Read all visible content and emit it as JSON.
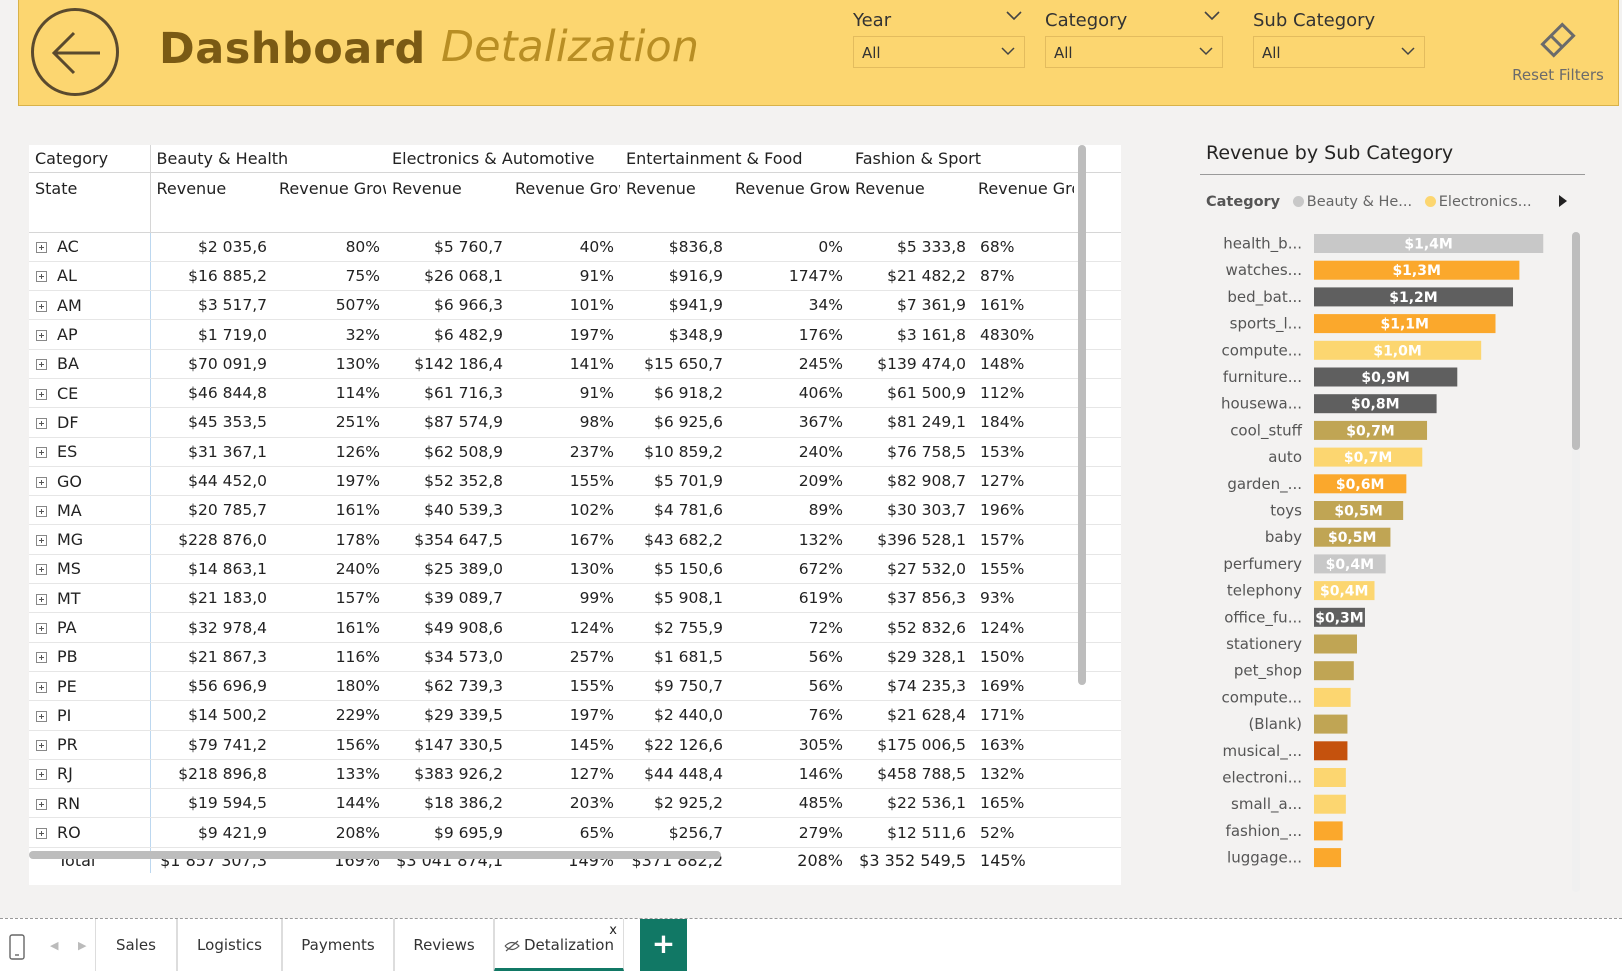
{
  "header": {
    "title": "Dashboard",
    "subtitle": "Detalization",
    "reset_label": "Reset Filters"
  },
  "filters": [
    {
      "label": "Year",
      "value": "All"
    },
    {
      "label": "Category",
      "value": "All"
    },
    {
      "label": "Sub Category",
      "value": "All"
    }
  ],
  "matrix": {
    "corner_col_header": "Category",
    "corner_row_header": "State",
    "categories": [
      "Beauty & Health",
      "Electronics & Automotive",
      "Entertainment & Food",
      "Fashion & Sport"
    ],
    "measure_headers": [
      "Revenue",
      "Revenue Growth %"
    ],
    "rows": [
      {
        "state": "AC",
        "cells": [
          "$2 035,6",
          "80%",
          "$5 760,7",
          "40%",
          "$836,8",
          "0%",
          "$5 333,8",
          "68%"
        ]
      },
      {
        "state": "AL",
        "cells": [
          "$16 885,2",
          "75%",
          "$26 068,1",
          "91%",
          "$916,9",
          "1747%",
          "$21 482,2",
          "87%"
        ]
      },
      {
        "state": "AM",
        "cells": [
          "$3 517,7",
          "507%",
          "$6 966,3",
          "101%",
          "$941,9",
          "34%",
          "$7 361,9",
          "161%"
        ]
      },
      {
        "state": "AP",
        "cells": [
          "$1 719,0",
          "32%",
          "$6 482,9",
          "197%",
          "$348,9",
          "176%",
          "$3 161,8",
          "4830%"
        ]
      },
      {
        "state": "BA",
        "cells": [
          "$70 091,9",
          "130%",
          "$142 186,4",
          "141%",
          "$15 650,7",
          "245%",
          "$139 474,0",
          "148%"
        ]
      },
      {
        "state": "CE",
        "cells": [
          "$46 844,8",
          "114%",
          "$61 716,3",
          "91%",
          "$6 918,2",
          "406%",
          "$61 500,9",
          "112%"
        ]
      },
      {
        "state": "DF",
        "cells": [
          "$45 353,5",
          "251%",
          "$87 574,9",
          "98%",
          "$6 925,6",
          "367%",
          "$81 249,1",
          "184%"
        ]
      },
      {
        "state": "ES",
        "cells": [
          "$31 367,1",
          "126%",
          "$62 508,9",
          "237%",
          "$10 859,2",
          "240%",
          "$76 758,5",
          "153%"
        ]
      },
      {
        "state": "GO",
        "cells": [
          "$44 452,0",
          "197%",
          "$52 352,8",
          "155%",
          "$5 701,9",
          "209%",
          "$82 908,7",
          "127%"
        ]
      },
      {
        "state": "MA",
        "cells": [
          "$20 785,7",
          "161%",
          "$40 539,3",
          "102%",
          "$4 781,6",
          "89%",
          "$30 303,7",
          "196%"
        ]
      },
      {
        "state": "MG",
        "cells": [
          "$228 876,0",
          "178%",
          "$354 647,5",
          "167%",
          "$43 682,2",
          "132%",
          "$396 528,1",
          "157%"
        ]
      },
      {
        "state": "MS",
        "cells": [
          "$14 863,1",
          "240%",
          "$25 389,0",
          "130%",
          "$5 150,6",
          "672%",
          "$27 532,0",
          "155%"
        ]
      },
      {
        "state": "MT",
        "cells": [
          "$21 183,0",
          "157%",
          "$39 089,7",
          "99%",
          "$5 908,1",
          "619%",
          "$37 856,3",
          "93%"
        ]
      },
      {
        "state": "PA",
        "cells": [
          "$32 978,4",
          "161%",
          "$49 908,6",
          "124%",
          "$2 755,9",
          "72%",
          "$52 832,6",
          "124%"
        ]
      },
      {
        "state": "PB",
        "cells": [
          "$21 867,3",
          "116%",
          "$34 573,0",
          "257%",
          "$1 681,5",
          "56%",
          "$29 328,1",
          "150%"
        ]
      },
      {
        "state": "PE",
        "cells": [
          "$56 696,9",
          "180%",
          "$62 739,3",
          "155%",
          "$9 750,7",
          "56%",
          "$74 235,3",
          "169%"
        ]
      },
      {
        "state": "PI",
        "cells": [
          "$14 500,2",
          "229%",
          "$29 339,5",
          "197%",
          "$2 440,0",
          "76%",
          "$21 628,4",
          "171%"
        ]
      },
      {
        "state": "PR",
        "cells": [
          "$79 741,2",
          "156%",
          "$147 330,5",
          "145%",
          "$22 126,6",
          "305%",
          "$175 006,5",
          "163%"
        ]
      },
      {
        "state": "RJ",
        "cells": [
          "$218 896,8",
          "133%",
          "$383 926,2",
          "127%",
          "$44 448,4",
          "146%",
          "$458 788,5",
          "132%"
        ]
      },
      {
        "state": "RN",
        "cells": [
          "$19 594,5",
          "144%",
          "$18 386,2",
          "203%",
          "$2 925,2",
          "485%",
          "$22 536,1",
          "165%"
        ]
      },
      {
        "state": "RO",
        "cells": [
          "$9 421,9",
          "208%",
          "$9 695,9",
          "65%",
          "$256,7",
          "279%",
          "$12 511,6",
          "52%"
        ]
      }
    ],
    "total": {
      "label": "Total",
      "cells": [
        "$1 857 307,3",
        "169%",
        "$3 041 874,1",
        "149%",
        "$371 882,2",
        "208%",
        "$3 352 549,5",
        "145%"
      ]
    }
  },
  "chart": {
    "title": "Revenue by Sub Category",
    "legend_title": "Category",
    "legend": [
      {
        "label": "Beauty & He...",
        "color": "#c8c8c8"
      },
      {
        "label": "Electronics...",
        "color": "#fcd670"
      }
    ]
  },
  "chart_data": {
    "type": "bar",
    "orientation": "horizontal",
    "title": "Revenue by Sub Category",
    "unit": "$M",
    "categories": [
      "health_b...",
      "watches...",
      "bed_bat...",
      "sports_l...",
      "compute...",
      "furniture...",
      "housewa...",
      "cool_stuff",
      "auto",
      "garden_...",
      "toys",
      "baby",
      "perfumery",
      "telephony",
      "office_fu...",
      "stationery",
      "pet_shop",
      "compute...",
      "(Blank)",
      "musical_...",
      "electroni...",
      "small_a...",
      "fashion_...",
      "luggage..."
    ],
    "values": [
      1.44,
      1.29,
      1.25,
      1.14,
      1.05,
      0.9,
      0.77,
      0.71,
      0.68,
      0.58,
      0.56,
      0.48,
      0.45,
      0.38,
      0.32,
      0.27,
      0.25,
      0.23,
      0.21,
      0.21,
      0.2,
      0.2,
      0.18,
      0.17
    ],
    "labels": [
      "$1,4M",
      "$1,3M",
      "$1,2M",
      "$1,1M",
      "$1,0M",
      "$0,9M",
      "$0,8M",
      "$0,7M",
      "$0,7M",
      "$0,6M",
      "$0,5M",
      "$0,5M",
      "$0,4M",
      "$0,4M",
      "$0,3M",
      "",
      "",
      "",
      "",
      "",
      "",
      "",
      "",
      ""
    ],
    "colors": [
      "#c8c8c8",
      "#fba82c",
      "#5f5f5f",
      "#fba82c",
      "#fcd670",
      "#5f5f5f",
      "#5f5f5f",
      "#c0a554",
      "#fcd670",
      "#fba82c",
      "#c0a554",
      "#c0a554",
      "#c8c8c8",
      "#fcd670",
      "#5f5f5f",
      "#c0a554",
      "#c0a554",
      "#fcd670",
      "#c0a554",
      "#c5520d",
      "#fcd670",
      "#fcd670",
      "#fba82c",
      "#fba82c"
    ]
  },
  "tabs": {
    "items": [
      "Sales",
      "Logistics",
      "Payments",
      "Reviews",
      "Detalization"
    ],
    "active": "Detalization",
    "add_label": "+",
    "close_label": "x"
  }
}
